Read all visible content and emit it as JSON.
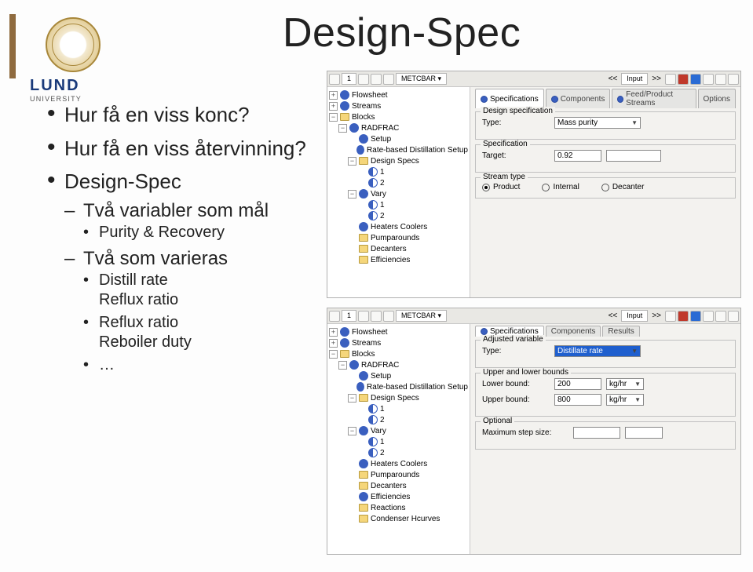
{
  "slide": {
    "title": "Design-Spec"
  },
  "logo": {
    "name": "LUND",
    "subtitle": "UNIVERSITY"
  },
  "bullets": {
    "b1": "Hur få en viss konc?",
    "b2": "Hur få en viss återvinning?",
    "b3": "Design-Spec",
    "s1": "Två variabler som mål",
    "ss1": "Purity & Recovery",
    "s2": "Två som varieras",
    "ss2a": "Distill rate\nReflux ratio",
    "ss2b": "Reflux ratio\nReboiler duty",
    "ss2c": "…"
  },
  "toolbar": {
    "counter": "1",
    "units": "METCBAR",
    "nav_prev": "<<",
    "nav_label": "Input",
    "nav_next": ">>"
  },
  "tree_top": {
    "flowsheet": "Flowsheet",
    "streams": "Streams",
    "blocks": "Blocks",
    "radfrac": "RADFRAC",
    "setup": "Setup",
    "rbds": "Rate-based Distillation Setup",
    "designspecs": "Design Specs",
    "n1": "1",
    "n2": "2",
    "vary": "Vary",
    "v1": "1",
    "v2": "2",
    "hc": "Heaters Coolers",
    "pa": "Pumparounds",
    "dec": "Decanters",
    "eff": "Efficiencies"
  },
  "tree_bottom": {
    "flowsheet": "Flowsheet",
    "streams": "Streams",
    "blocks": "Blocks",
    "radfrac": "RADFRAC",
    "setup": "Setup",
    "rbds": "Rate-based Distillation Setup",
    "designspecs": "Design Specs",
    "n1": "1",
    "n2": "2",
    "vary": "Vary",
    "v1": "1",
    "v2": "2",
    "hc": "Heaters Coolers",
    "pa": "Pumparounds",
    "dec": "Decanters",
    "eff": "Efficiencies",
    "rea": "Reactions",
    "ch": "Condenser Hcurves"
  },
  "form_top": {
    "tabs": {
      "spec": "Specifications",
      "comp": "Components",
      "fps": "Feed/Product Streams",
      "opt": "Options"
    },
    "g1": "Design specification",
    "type_lbl": "Type:",
    "type_val": "Mass purity",
    "g2": "Specification",
    "target_lbl": "Target:",
    "target_val": "0.92",
    "g3": "Stream type",
    "r_product": "Product",
    "r_internal": "Internal",
    "r_decanter": "Decanter"
  },
  "form_bottom": {
    "tabs": {
      "spec": "Specifications",
      "comp": "Components",
      "res": "Results"
    },
    "g1": "Adjusted variable",
    "type_lbl": "Type:",
    "type_val": "Distillate rate",
    "g2": "Upper and lower bounds",
    "lb_lbl": "Lower bound:",
    "lb_val": "200",
    "ub_lbl": "Upper bound:",
    "ub_val": "800",
    "unit": "kg/hr",
    "g3": "Optional",
    "step_lbl": "Maximum step size:"
  }
}
